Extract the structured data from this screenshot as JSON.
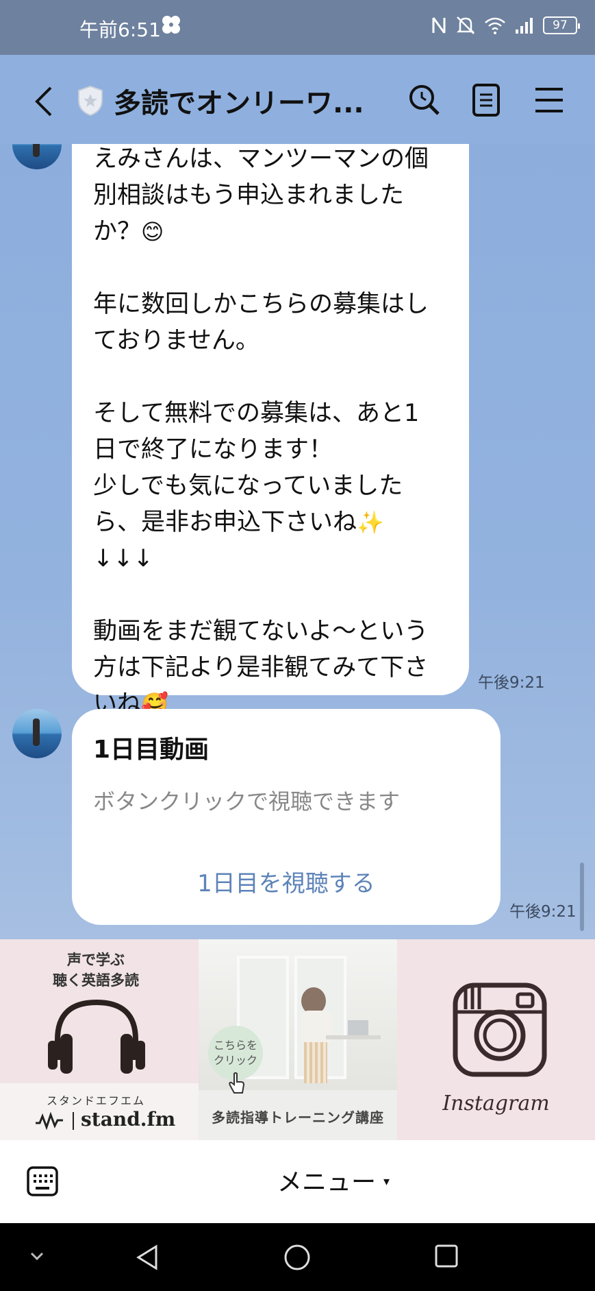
{
  "status_bar": {
    "time": "午前6:51",
    "battery": "97",
    "icons": [
      "fan-icon",
      "nfc-icon",
      "bell-off-icon",
      "wifi-icon",
      "signal-icon",
      "battery-icon"
    ]
  },
  "header": {
    "title": "多読でオンリーワ...",
    "icons": [
      "back-arrow-icon",
      "shield-icon",
      "search-icon",
      "notes-icon",
      "menu-icon"
    ]
  },
  "messages": [
    {
      "paragraphs": [
        [
          "えみさんは、マンツーマンの個",
          "別相談はもう申込まれました",
          "か？"
        ],
        [
          "年に数回しかこちらの募集はし",
          "ておりません。"
        ],
        [
          "そして無料での募集は、あと1",
          "日で終了になります！",
          "少しでも気になっていました",
          "ら、是非お申込下さいね",
          "↓↓↓"
        ],
        [
          "動画をまだ観てないよ〜という",
          "方は下記より是非観てみて下さ",
          "いね"
        ]
      ],
      "emojis": [
        "😊",
        "✨",
        "🥰"
      ],
      "time": "午後9:21"
    },
    {
      "card_title": "1日目動画",
      "card_subtitle": "ボタンクリックで視聴できます",
      "card_button": "1日目を視聴する",
      "time": "午後9:21"
    }
  ],
  "rich_menu": {
    "stand": {
      "line1": "声で学ぶ",
      "line2": "聴く英語多読",
      "katakana": "スタンドエフエム",
      "brand": "stand.fm"
    },
    "training": {
      "bubble_line1": "こちらを",
      "bubble_line2": "クリック",
      "label": "多読指導トレーニング講座"
    },
    "instagram": {
      "label": "Instagram"
    }
  },
  "bottom": {
    "menu_label": "メニュー",
    "caret": "▾"
  },
  "nav": {
    "icons": [
      "nav-hide-icon",
      "nav-back-icon",
      "nav-home-icon",
      "nav-recents-icon"
    ]
  },
  "colors": {
    "status_bar": "#6e819e",
    "chat_bg": "#8fb0de",
    "card_button": "#5d83b8",
    "rich_menu_pink": "#f1e3e6"
  }
}
